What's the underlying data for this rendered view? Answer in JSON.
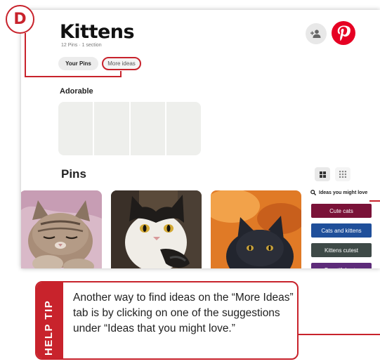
{
  "step_badge": "D",
  "board": {
    "title": "Kittens",
    "meta": "12 Pins · 1 section"
  },
  "tabs": [
    {
      "label": "Your Pins",
      "active": true
    },
    {
      "label": "More ideas",
      "active": false,
      "highlighted": true
    }
  ],
  "section": {
    "title": "Adorable"
  },
  "pins": {
    "title": "Pins",
    "view_options": [
      "grid-view-icon",
      "compact-view-icon"
    ]
  },
  "ideas": {
    "heading": "Ideas you might love",
    "items": [
      {
        "label": "Cute cats",
        "color": "#7a1238"
      },
      {
        "label": "Cats and kittens",
        "color": "#1f4f9a"
      },
      {
        "label": "Kittens cutest",
        "color": "#3e4a47"
      },
      {
        "label": "Beautiful cats",
        "color": "#5d2b79"
      }
    ]
  },
  "help_tip": {
    "label": "HELP TIP",
    "text": "Another way to find ideas on the “More Ideas” tab is by clicking on one of the suggestions under “Ideas that you might love.”"
  },
  "colors": {
    "accent": "#c8232c",
    "pinterest_red": "#e60023"
  }
}
